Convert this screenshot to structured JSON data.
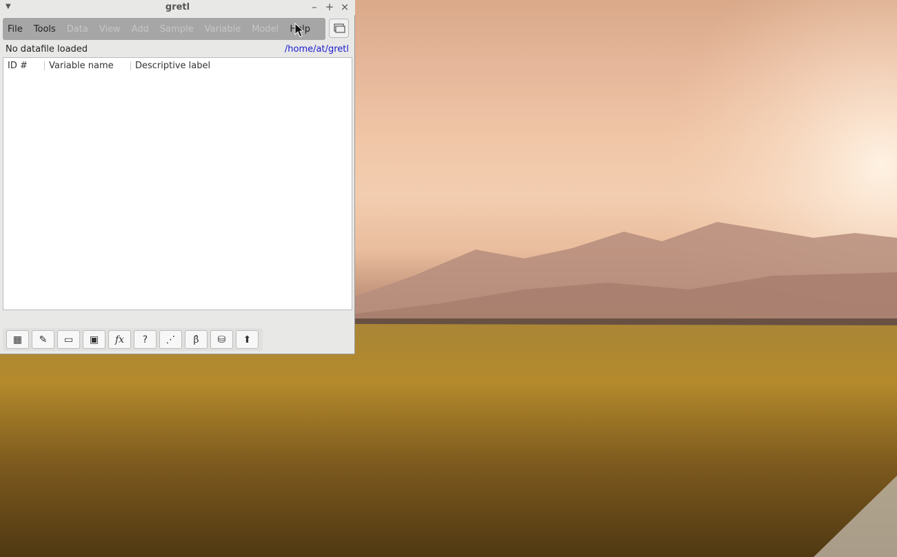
{
  "window": {
    "title": "gretl",
    "menu": [
      {
        "label": "File",
        "enabled": true
      },
      {
        "label": "Tools",
        "enabled": true
      },
      {
        "label": "Data",
        "enabled": false
      },
      {
        "label": "View",
        "enabled": false
      },
      {
        "label": "Add",
        "enabled": false
      },
      {
        "label": "Sample",
        "enabled": false
      },
      {
        "label": "Variable",
        "enabled": false
      },
      {
        "label": "Model",
        "enabled": false
      },
      {
        "label": "Help",
        "enabled": true
      }
    ],
    "status_left": "No datafile loaded",
    "status_right": "/home/at/gretl",
    "columns": [
      "ID #",
      "Variable name",
      "Descriptive label"
    ],
    "toolbar_icons": [
      {
        "name": "calculator-icon",
        "glyph": "▦"
      },
      {
        "name": "edit-icon",
        "glyph": "✎"
      },
      {
        "name": "console-icon",
        "glyph": "▭"
      },
      {
        "name": "session-icon",
        "glyph": "▣"
      },
      {
        "name": "function-icon",
        "glyph": "fx"
      },
      {
        "name": "help-icon",
        "glyph": "?"
      },
      {
        "name": "graph-icon",
        "glyph": "⋰"
      },
      {
        "name": "model-icon",
        "glyph": "β̂"
      },
      {
        "name": "database-icon",
        "glyph": "⛁"
      },
      {
        "name": "upload-icon",
        "glyph": "⬆"
      }
    ]
  },
  "colors": {
    "menubar": "#a6a6a6",
    "path_link": "#1a1ad0",
    "window_bg": "#e8e8e7"
  }
}
